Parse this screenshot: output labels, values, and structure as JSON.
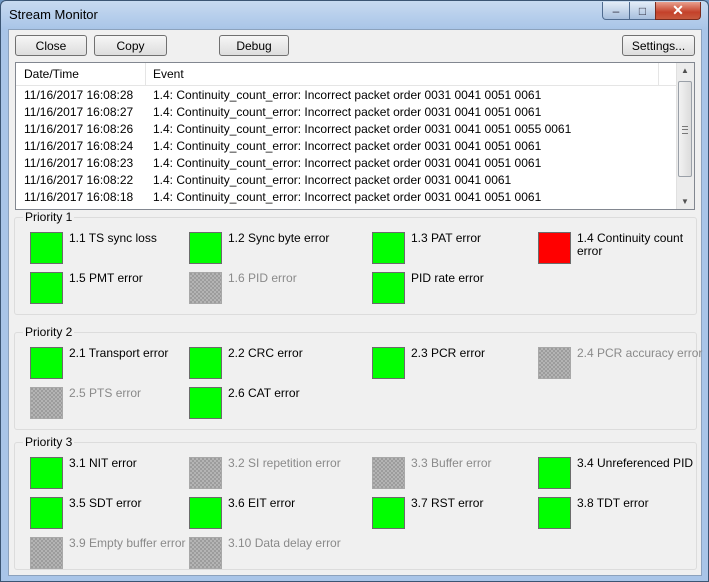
{
  "window": {
    "title": "Stream Monitor",
    "minimize_glyph": "–",
    "maximize_glyph": "□",
    "close_glyph": "✕"
  },
  "toolbar": {
    "close_label": "Close",
    "copy_label": "Copy",
    "debug_label": "Debug",
    "settings_label": "Settings..."
  },
  "log": {
    "columns": [
      "Date/Time",
      "Event"
    ],
    "rows": [
      {
        "time": "11/16/2017 16:08:28",
        "event": "1.4: Continuity_count_error: Incorrect packet order 0031 0041 0051 0061"
      },
      {
        "time": "11/16/2017 16:08:27",
        "event": "1.4: Continuity_count_error: Incorrect packet order 0031 0041 0051 0061"
      },
      {
        "time": "11/16/2017 16:08:26",
        "event": "1.4: Continuity_count_error: Incorrect packet order 0031 0041 0051 0055 0061"
      },
      {
        "time": "11/16/2017 16:08:24",
        "event": "1.4: Continuity_count_error: Incorrect packet order 0031 0041 0051 0061"
      },
      {
        "time": "11/16/2017 16:08:23",
        "event": "1.4: Continuity_count_error: Incorrect packet order 0031 0041 0051 0061"
      },
      {
        "time": "11/16/2017 16:08:22",
        "event": "1.4: Continuity_count_error: Incorrect packet order 0031 0041 0061"
      },
      {
        "time": "11/16/2017 16:08:18",
        "event": "1.4: Continuity_count_error: Incorrect packet order 0031 0041 0051 0061"
      }
    ]
  },
  "colors": {
    "ok": "#00ff00",
    "error": "#ff0000",
    "disabled": "#9c9c9c"
  },
  "priorities": [
    {
      "title": "Priority 1",
      "indicators": [
        {
          "label": "1.1 TS sync loss",
          "status": "ok"
        },
        {
          "label": "1.2 Sync byte error",
          "status": "ok"
        },
        {
          "label": "1.3 PAT error",
          "status": "ok"
        },
        {
          "label": "1.4 Continuity count error",
          "status": "error"
        },
        {
          "label": "1.5 PMT error",
          "status": "ok"
        },
        {
          "label": "1.6 PID error",
          "status": "disabled"
        },
        {
          "label": "PID rate error",
          "status": "ok"
        }
      ]
    },
    {
      "title": "Priority 2",
      "indicators": [
        {
          "label": "2.1 Transport error",
          "status": "ok"
        },
        {
          "label": "2.2 CRC error",
          "status": "ok"
        },
        {
          "label": "2.3 PCR error",
          "status": "ok"
        },
        {
          "label": "2.4 PCR accuracy error",
          "status": "disabled"
        },
        {
          "label": "2.5 PTS error",
          "status": "disabled"
        },
        {
          "label": "2.6 CAT error",
          "status": "ok"
        }
      ]
    },
    {
      "title": "Priority 3",
      "indicators": [
        {
          "label": "3.1 NIT error",
          "status": "ok"
        },
        {
          "label": "3.2 SI repetition error",
          "status": "disabled"
        },
        {
          "label": "3.3 Buffer error",
          "status": "disabled"
        },
        {
          "label": "3.4 Unreferenced PID",
          "status": "ok"
        },
        {
          "label": "3.5 SDT error",
          "status": "ok"
        },
        {
          "label": "3.6 EIT error",
          "status": "ok"
        },
        {
          "label": "3.7 RST error",
          "status": "ok"
        },
        {
          "label": "3.8 TDT error",
          "status": "ok"
        },
        {
          "label": "3.9 Empty buffer error",
          "status": "disabled"
        },
        {
          "label": "3.10 Data delay error",
          "status": "disabled"
        }
      ]
    }
  ]
}
